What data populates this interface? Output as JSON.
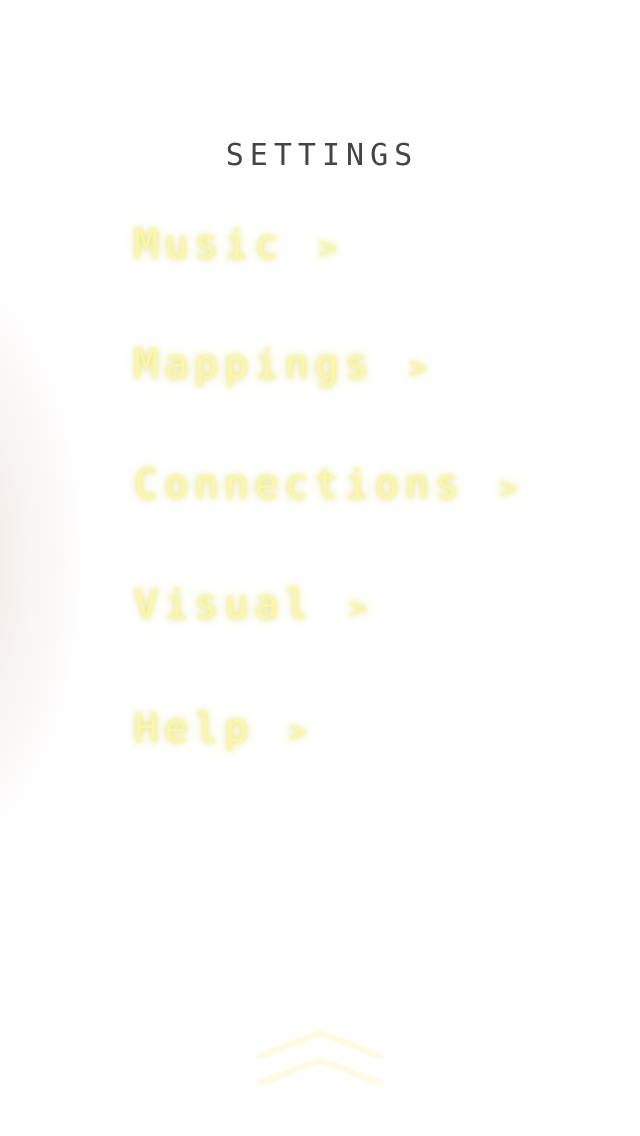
{
  "title": "SETTINGS",
  "menu": [
    {
      "label": "Music",
      "chevron": ">"
    },
    {
      "label": "Mappings",
      "chevron": ">"
    },
    {
      "label": "Connections",
      "chevron": ">"
    },
    {
      "label": "Visual",
      "chevron": ">"
    },
    {
      "label": "Help",
      "chevron": ">"
    }
  ],
  "colors": {
    "item": "#fbf7a8",
    "title": "#444440"
  }
}
